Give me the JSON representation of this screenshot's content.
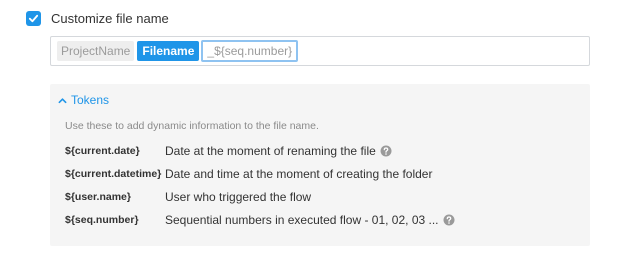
{
  "customize": {
    "checked": true,
    "label": "Customize file name"
  },
  "filename": {
    "project_chip": "ProjectName",
    "filename_chip": "Filename",
    "seq_chip": "_${seq.number}"
  },
  "tokens": {
    "toggle_label": "Tokens",
    "hint": "Use these to add dynamic information to the file name.",
    "items": [
      {
        "code": "${current.date}",
        "desc": "Date at the moment of renaming the file",
        "help": true
      },
      {
        "code": "${current.datetime}",
        "desc": "Date and time at the moment of creating the folder",
        "help": false
      },
      {
        "code": "${user.name}",
        "desc": "User who triggered the flow",
        "help": false
      },
      {
        "code": "${seq.number}",
        "desc": "Sequential numbers in executed flow - 01, 02, 03 ...",
        "help": true
      }
    ]
  },
  "colors": {
    "accent": "#1f95e8",
    "panel_bg": "#f5f5f5",
    "focus_border": "#8fc3f1"
  }
}
